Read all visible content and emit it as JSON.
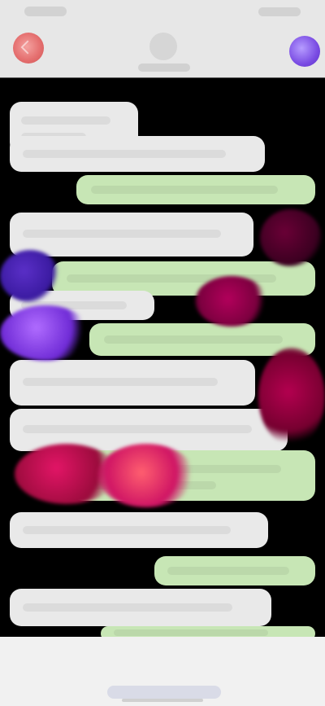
{
  "colors": {
    "background": "#000000",
    "header_bg": "#e7e7e7",
    "incoming_bubble": "#e9e9e9",
    "outgoing_bubble": "#c7e6b5",
    "accent_purple": "#7a4ce3",
    "accent_red": "#e57070"
  },
  "icons": {
    "back": "chevron-left-icon",
    "action": "call-icon"
  },
  "messages": [
    {
      "direction": "incoming"
    },
    {
      "direction": "incoming"
    },
    {
      "direction": "outgoing"
    },
    {
      "direction": "incoming"
    },
    {
      "direction": "outgoing"
    },
    {
      "direction": "incoming"
    },
    {
      "direction": "outgoing"
    },
    {
      "direction": "incoming"
    },
    {
      "direction": "incoming"
    },
    {
      "direction": "outgoing"
    },
    {
      "direction": "incoming"
    },
    {
      "direction": "outgoing"
    },
    {
      "direction": "incoming"
    },
    {
      "direction": "outgoing"
    }
  ]
}
